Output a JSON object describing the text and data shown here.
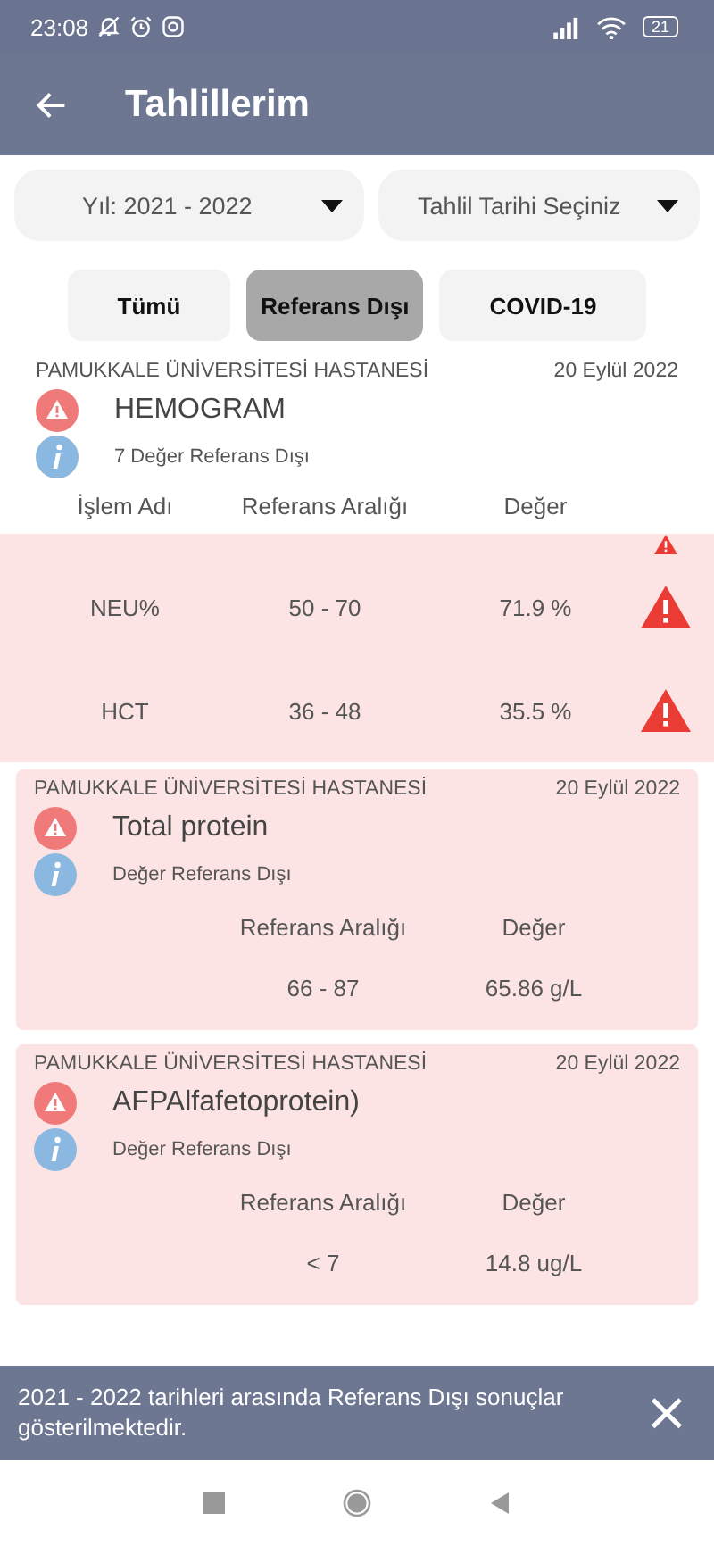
{
  "status_bar": {
    "time": "23:08",
    "battery": "21"
  },
  "app_bar": {
    "title": "Tahlillerim"
  },
  "dropdowns": [
    {
      "value": "Yıl: 2021 - 2022"
    },
    {
      "value": "Tahlil Tarihi Seçiniz"
    }
  ],
  "filters": [
    {
      "label": "Tümü",
      "selected": false
    },
    {
      "label": "Referans Dışı",
      "selected": true
    },
    {
      "label": "COVID-19",
      "selected": false
    }
  ],
  "results": [
    {
      "kind": "group",
      "hospital": "PAMUKKALE ÜNİVERSİTESİ HASTANESİ",
      "date": "20 Eylül 2022",
      "title": "HEMOGRAM",
      "note": "7 Değer Referans Dışı",
      "headers": [
        "İşlem Adı",
        "Referans Aralığı",
        "Değer"
      ],
      "partial_row": true,
      "rows": [
        {
          "name": "NEU%",
          "range": "50 - 70",
          "value": "71.9 %",
          "flagged": true
        },
        {
          "name": "HCT",
          "range": "36 - 48",
          "value": "35.5 %",
          "flagged": true
        }
      ]
    },
    {
      "kind": "single",
      "hospital": "PAMUKKALE ÜNİVERSİTESİ HASTANESİ",
      "date": "20 Eylül 2022",
      "title": "Total protein",
      "note": "Değer Referans Dışı",
      "headers": [
        "Referans Aralığı",
        "Değer"
      ],
      "rows": [
        {
          "range": "66 - 87",
          "value": "65.86 g/L",
          "flagged": false
        }
      ]
    },
    {
      "kind": "single",
      "hospital": "PAMUKKALE ÜNİVERSİTESİ HASTANESİ",
      "date": "20 Eylül 2022",
      "title": "AFPAlfafetoprotein)",
      "note": "Değer Referans Dışı",
      "headers": [
        "Referans Aralığı",
        "Değer"
      ],
      "rows": [
        {
          "range": "< 7",
          "value": "14.8 ug/L",
          "flagged": false
        }
      ]
    }
  ],
  "snackbar": {
    "message": "2021 - 2022 tarihleri arasında Referans Dışı sonuçlar gösterilmektedir.",
    "close": "×"
  }
}
